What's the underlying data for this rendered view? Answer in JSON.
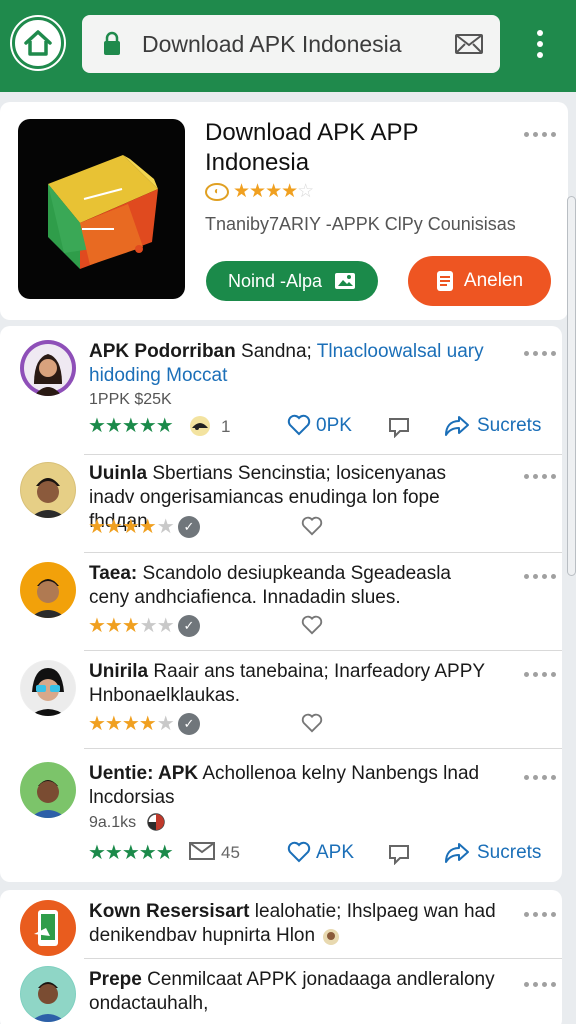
{
  "browser": {
    "url": "Download APK Indonesia",
    "theme_color": "#1f8a4c"
  },
  "app": {
    "title": "Download APK APP Indonesia",
    "rating_stars": 3.5,
    "subtitle": "Tnanibу7ARIY -APPK ClPy Counisisas",
    "install_label": "Noind -Alpa",
    "open_label": "Anelen",
    "accent_green": "#1b8a4a",
    "accent_orange": "#ee5522"
  },
  "reviews": [
    {
      "author": "APK Podorriban",
      "text": "Sandna;",
      "highlight": "Tlnacloowalsal uary hidoding Moccat",
      "meta": "1PPK $25K",
      "stars": 5,
      "star_color": "green",
      "count": "1",
      "like_label": "0PK",
      "share_label": "Sucrets"
    },
    {
      "author": "Uuinla",
      "text": "Sbertians Sencinstia; losicenyanas inadv ongerisamiancas enudinga lon fope fhdдan.",
      "stars": 3.5,
      "star_color": "orange"
    },
    {
      "author": "Taea:",
      "text": "Scandolo desiupkeanda Sgeadeasla ceny andhciafienca. Innadadin slues.",
      "stars": 3,
      "star_color": "orange"
    },
    {
      "author": "Unirila",
      "text": "Raair ans tanebaina; Inarfeadory APPY Hnbonaelklaukas.",
      "stars": 3.5,
      "star_color": "orange"
    },
    {
      "author": "Uentie: APK",
      "text": "Achollenoa kelny Nanbengs lnad lncdorsias",
      "meta": "9a.1ks",
      "stars": 5,
      "star_color": "green",
      "count": "45",
      "like_label": "APK",
      "share_label": "Sucrets"
    },
    {
      "author": "Kown Resersisart",
      "text": "lealohatie; Ihslpaeg wan had denikendbav hupnirta Hlon"
    },
    {
      "author": "Prepe",
      "text": "Cenmilcaat APPK jonadaaga andleralony ondactauhalh,"
    }
  ]
}
